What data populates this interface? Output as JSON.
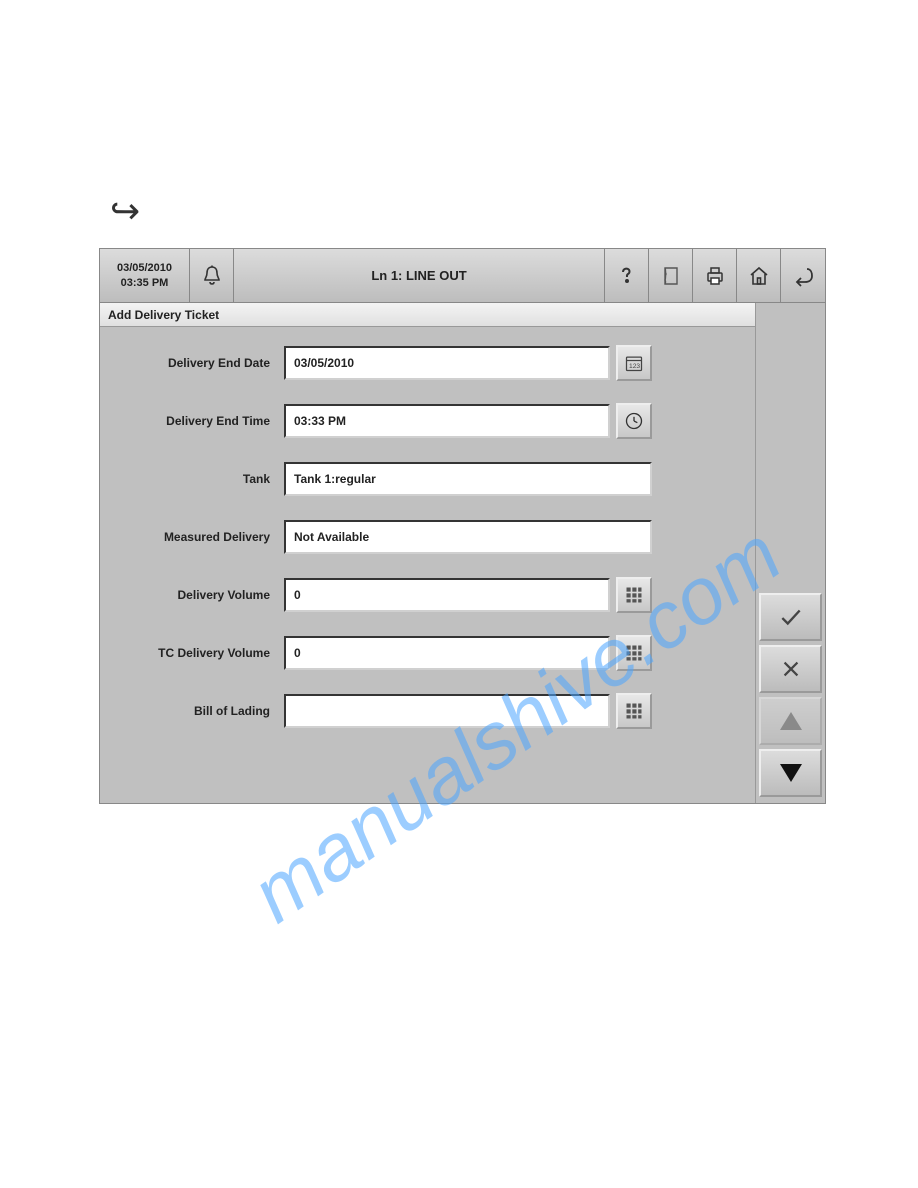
{
  "header": {
    "date": "03/05/2010",
    "time": "03:35 PM",
    "title": "Ln 1: LINE OUT"
  },
  "subheader": "Add Delivery Ticket",
  "fields": {
    "delivery_end_date": {
      "label": "Delivery End Date",
      "value": "03/05/2010"
    },
    "delivery_end_time": {
      "label": "Delivery End Time",
      "value": "03:33 PM"
    },
    "tank": {
      "label": "Tank",
      "value": "Tank 1:regular"
    },
    "measured_delivery": {
      "label": "Measured Delivery",
      "value": "Not Available"
    },
    "delivery_volume": {
      "label": "Delivery Volume",
      "value": "0"
    },
    "tc_delivery_volume": {
      "label": "TC Delivery Volume",
      "value": "0"
    },
    "bill_of_lading": {
      "label": "Bill of Lading",
      "value": ""
    }
  },
  "watermark": "manualshive.com"
}
